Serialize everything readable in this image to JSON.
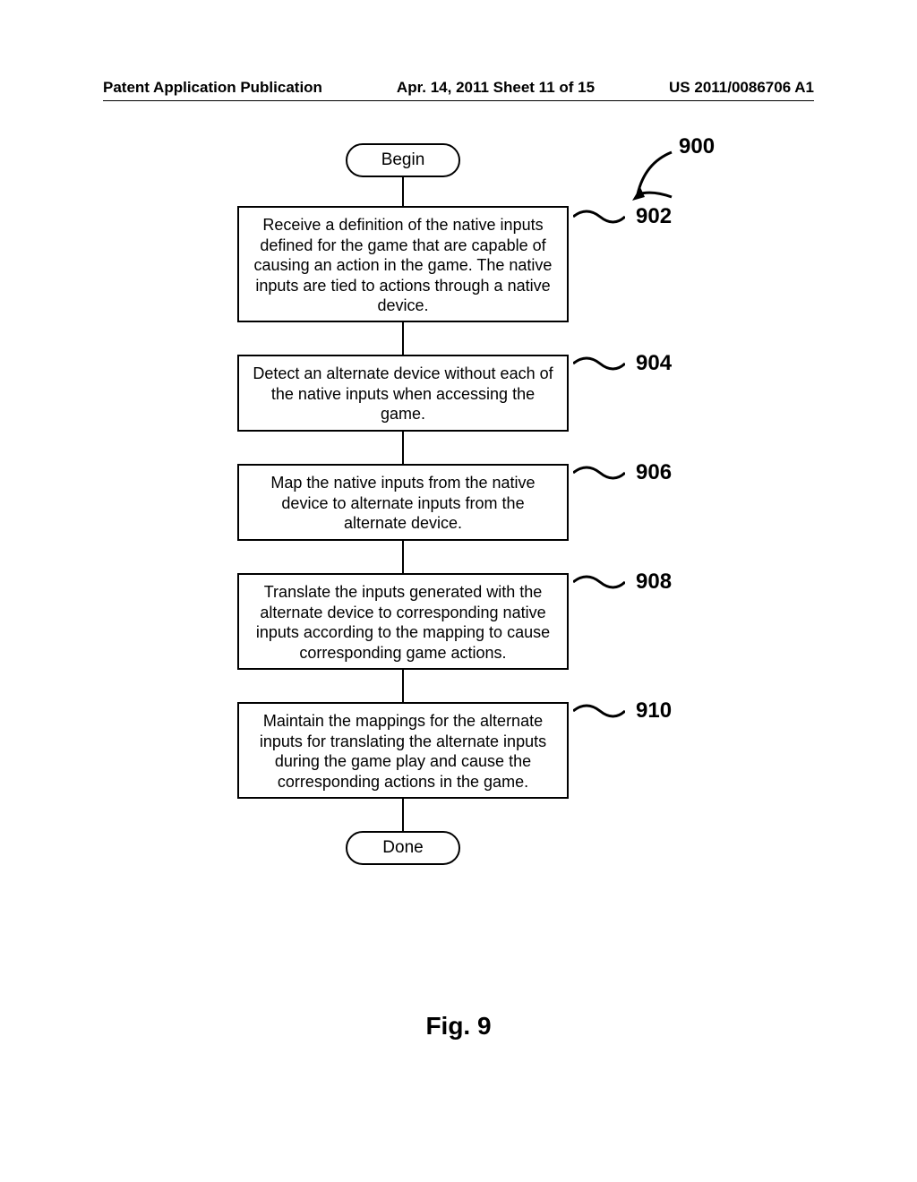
{
  "header": {
    "left": "Patent Application Publication",
    "mid": "Apr. 14, 2011  Sheet 11 of 15",
    "right": "US 2011/0086706 A1"
  },
  "flow": {
    "begin": "Begin",
    "done": "Done",
    "steps": [
      {
        "ref": "902",
        "text": "Receive a definition of the native inputs defined for the game that are capable of causing an action in the game. The native inputs are tied to actions through a native device."
      },
      {
        "ref": "904",
        "text": "Detect an alternate device without each of the native inputs when accessing the game."
      },
      {
        "ref": "906",
        "text": "Map the native inputs from the native device to alternate inputs from the alternate device."
      },
      {
        "ref": "908",
        "text": "Translate the inputs generated with the alternate device to corresponding native inputs according to the mapping to cause corresponding game actions."
      },
      {
        "ref": "910",
        "text": "Maintain the mappings for the alternate inputs for translating the alternate inputs during the game play and cause the corresponding actions in the game."
      }
    ],
    "diagram_ref": "900"
  },
  "figure_caption": "Fig. 9"
}
